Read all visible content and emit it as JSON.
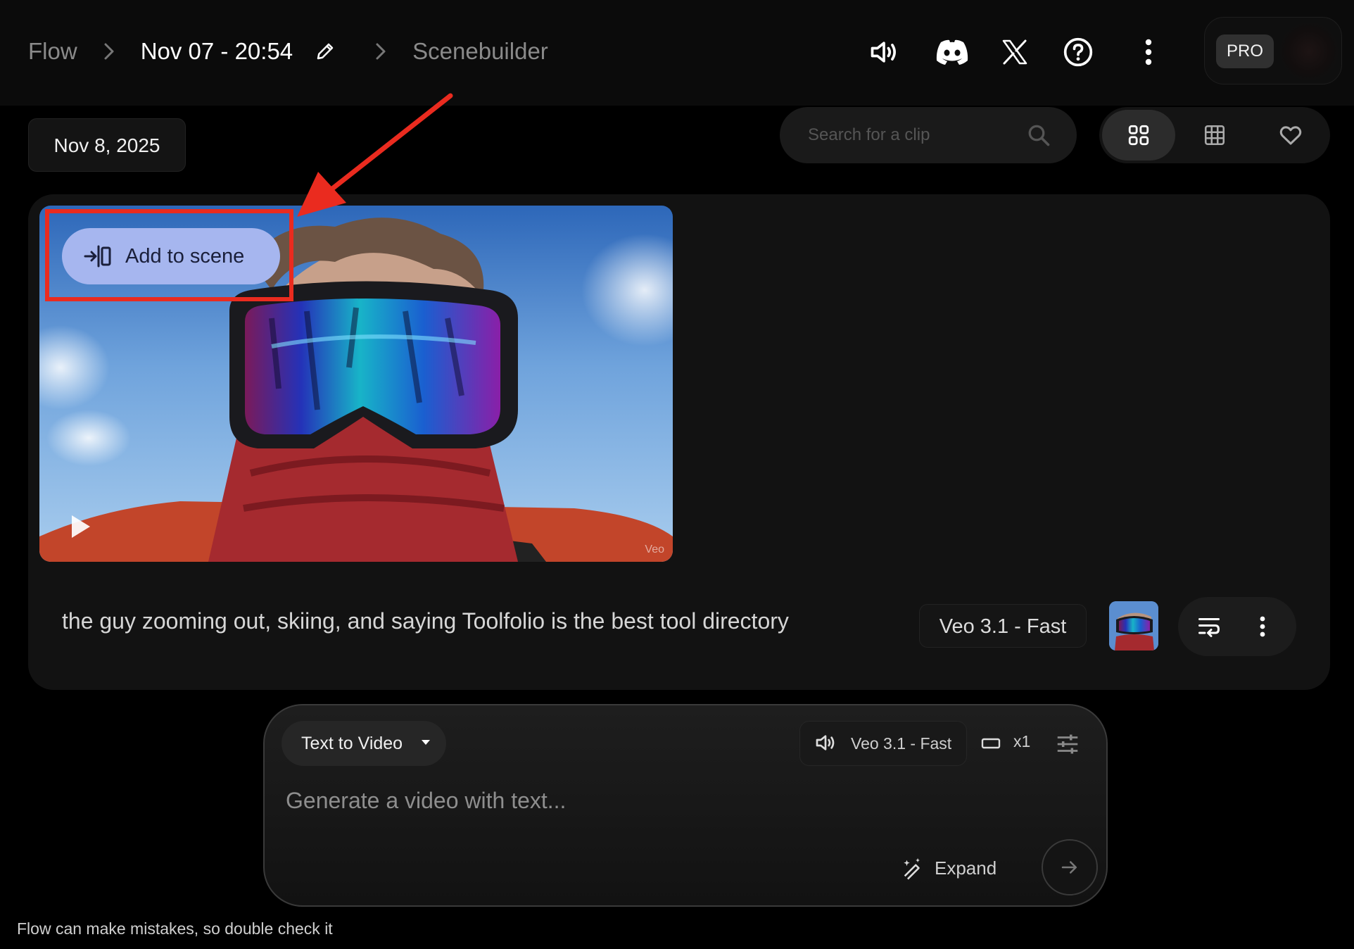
{
  "breadcrumb": {
    "root": "Flow",
    "project": "Nov 07 - 20:54",
    "section": "Scenebuilder"
  },
  "topbar_icons": [
    "speaker-icon",
    "discord-icon",
    "x-logo-icon",
    "help-icon",
    "more-vert-icon"
  ],
  "plan_badge": "PRO",
  "date_chip": "Nov 8, 2025",
  "search": {
    "placeholder": "Search for a clip"
  },
  "view_modes": [
    {
      "icon": "grid-large-icon",
      "active": true
    },
    {
      "icon": "grid-small-icon",
      "active": false
    },
    {
      "icon": "heart-icon",
      "active": false
    }
  ],
  "clip": {
    "add_to_scene_label": "Add to scene",
    "watermark": "Veo",
    "prompt": "the guy zooming out, skiing, and saying Toolfolio is the best tool directory",
    "model": "Veo 3.1 - Fast"
  },
  "composer": {
    "mode": "Text to Video",
    "model": "Veo 3.1 - Fast",
    "count": "x1",
    "placeholder": "Generate a video with text...",
    "expand_label": "Expand"
  },
  "disclaimer": "Flow can make mistakes, so double check it",
  "colors": {
    "background": "#000000",
    "add_button": "#a6b6ef",
    "annotation": "#ea2b1f"
  }
}
